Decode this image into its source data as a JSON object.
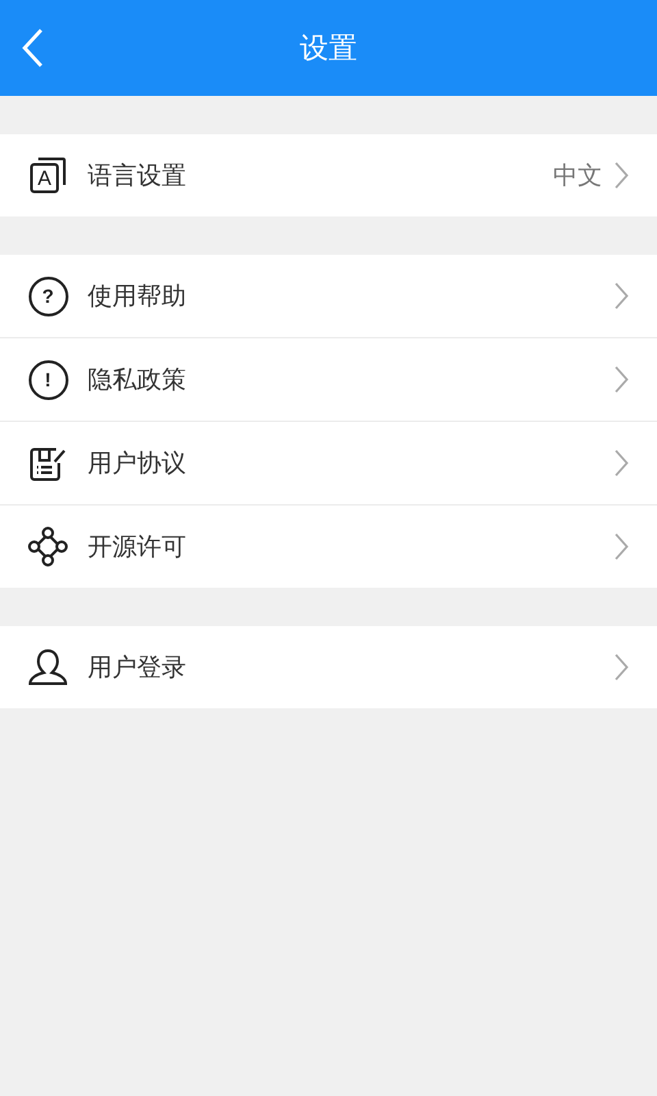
{
  "header": {
    "title": "设置"
  },
  "groups": [
    {
      "items": [
        {
          "kind": "boxed",
          "glyph": "A",
          "label": "语言设置",
          "value": "中文"
        }
      ]
    },
    {
      "items": [
        {
          "kind": "circled",
          "glyph": "?",
          "label": "使用帮助"
        },
        {
          "kind": "circled",
          "glyph": "!",
          "label": "隐私政策"
        },
        {
          "kind": "document",
          "label": "用户协议"
        },
        {
          "kind": "network",
          "label": "开源许可"
        }
      ]
    },
    {
      "items": [
        {
          "kind": "person",
          "label": "用户登录"
        }
      ]
    }
  ]
}
